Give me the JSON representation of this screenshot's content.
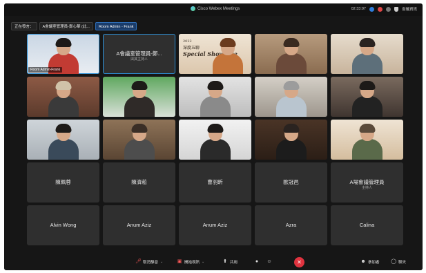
{
  "app": {
    "title": "Cisco Webex Meetings",
    "time": "02:33:07",
    "right_label": "會議資訊"
  },
  "speaker_bar": {
    "view_label": "正在發言：",
    "speaker": "A會議室管理員-鄭心華 (此...",
    "host_tag": "Room Admin - Frank"
  },
  "tiles": [
    {
      "type": "video",
      "label": "Room Admin-Frank",
      "highlight": true
    },
    {
      "type": "name",
      "name": "A會議室管理員-鄭...",
      "sub": "與其主持人",
      "highlight": true
    },
    {
      "type": "poster",
      "poster": {
        "l1": "2022",
        "l2": "深度五聊",
        "l3": "Special Showcase"
      }
    },
    {
      "type": "video"
    },
    {
      "type": "video"
    },
    {
      "type": "video"
    },
    {
      "type": "video"
    },
    {
      "type": "video"
    },
    {
      "type": "video"
    },
    {
      "type": "video"
    },
    {
      "type": "video"
    },
    {
      "type": "video"
    },
    {
      "type": "video"
    },
    {
      "type": "video"
    },
    {
      "type": "video"
    },
    {
      "type": "name",
      "name": "陳珮蓉"
    },
    {
      "type": "name",
      "name": "陳濟菘"
    },
    {
      "type": "name",
      "name": "曹羽昕"
    },
    {
      "type": "name",
      "name": "歐冠邑"
    },
    {
      "type": "name",
      "name": "A場會議管理員",
      "sub": "主持人"
    },
    {
      "type": "name",
      "name": "Alvin Wong"
    },
    {
      "type": "name",
      "name": "Anum Aziz"
    },
    {
      "type": "name",
      "name": "Anum Aziz"
    },
    {
      "type": "name",
      "name": "Azra"
    },
    {
      "type": "name",
      "name": "Calina"
    }
  ],
  "controls": {
    "mute": "取消靜音",
    "video": "開始視訊",
    "share": "共用",
    "participants": "參加者",
    "chat": "聊天"
  },
  "icons": [
    "webex-logo",
    "mic-muted-icon",
    "camera-off-icon",
    "share-icon",
    "record-icon",
    "reaction-icon",
    "end-call-icon",
    "participants-icon",
    "chat-icon"
  ],
  "colors": {
    "background": "#161616",
    "tile": "#2f2f2f",
    "highlight": "#2b8fd6",
    "end_call": "#e0333f",
    "mute_red": "#ff5a5a"
  }
}
